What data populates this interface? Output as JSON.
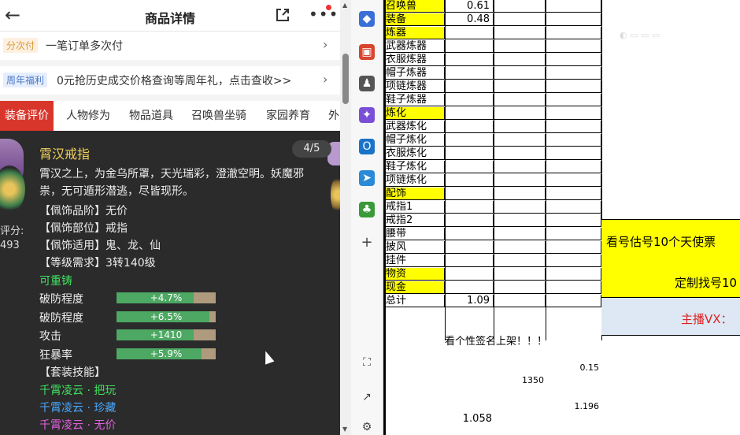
{
  "phone": {
    "title": "商品详情",
    "row1": {
      "tag": "分次付",
      "text": "一笔订单多次付"
    },
    "row2": {
      "tag": "周年福利",
      "text": "0元抢历史成交价格查询等周年礼，点击查收>>"
    },
    "tabs": [
      "装备评价",
      "人物修为",
      "物品道具",
      "召唤兽坐骑",
      "家园养育",
      "外"
    ],
    "card": {
      "name": "霄汉戒指",
      "page": "4/5",
      "score_label": "评分:",
      "score_value": "493",
      "desc": "霄汉之上，为金乌所罩，天光瑞彩，澄澈空明。妖魔邪祟，无可遁形潜逃，尽皆现形。",
      "lines": [
        "【佩饰品阶】无价",
        "【佩饰部位】戒指",
        "【佩饰适用】鬼、龙、仙",
        "【等级需求】3转140级"
      ],
      "recast": "可重铸",
      "stats": [
        {
          "label": "破防程度",
          "value": "+4.7%",
          "fill": 0.78
        },
        {
          "label": "破防程度",
          "value": "+6.5%",
          "fill": 0.94
        },
        {
          "label": "攻击",
          "value": "+1410",
          "fill": 0.78
        },
        {
          "label": "狂暴率",
          "value": "+5.9%",
          "fill": 0.86
        }
      ],
      "set_title": "【套装技能】",
      "set_items": [
        "千霄凌云 · 把玩",
        "千霄凌云 · 珍藏",
        "千霄凌云 · 无价"
      ]
    }
  },
  "sheet": {
    "rows": [
      {
        "label": "召唤兽",
        "val": "0.61",
        "yellow": true
      },
      {
        "label": "装备",
        "val": "0.48",
        "yellow": true
      },
      {
        "label": "炼器",
        "val": "",
        "yellow": true
      },
      {
        "label": "武器炼器",
        "val": "",
        "yellow": false
      },
      {
        "label": "衣服炼器",
        "val": "",
        "yellow": false
      },
      {
        "label": "帽子炼器",
        "val": "",
        "yellow": false
      },
      {
        "label": "项链炼器",
        "val": "",
        "yellow": false
      },
      {
        "label": "鞋子炼器",
        "val": "",
        "yellow": false
      },
      {
        "label": "炼化",
        "val": "",
        "yellow": true
      },
      {
        "label": "武器炼化",
        "val": "",
        "yellow": false
      },
      {
        "label": "帽子炼化",
        "val": "",
        "yellow": false
      },
      {
        "label": "衣服炼化",
        "val": "",
        "yellow": false
      },
      {
        "label": "鞋子炼化",
        "val": "",
        "yellow": false
      },
      {
        "label": "项链炼化",
        "val": "",
        "yellow": false
      },
      {
        "label": "配饰",
        "val": "",
        "yellow": true
      },
      {
        "label": "戒指1",
        "val": "",
        "yellow": false
      },
      {
        "label": "戒指2",
        "val": "",
        "yellow": false
      },
      {
        "label": "腰带",
        "val": "",
        "yellow": false
      },
      {
        "label": "披风",
        "val": "",
        "yellow": false
      },
      {
        "label": "挂件",
        "val": "",
        "yellow": false
      },
      {
        "label": "物资",
        "val": "",
        "yellow": true
      },
      {
        "label": "现金",
        "val": "",
        "yellow": true
      },
      {
        "label": "总计",
        "val": "1.09",
        "yellow": false
      }
    ],
    "signature": "看个性签名上架！！！",
    "extra_numbers": [
      {
        "text": "0.15"
      },
      {
        "text": "1350"
      },
      {
        "text": "1.196"
      },
      {
        "text": "1.058"
      }
    ],
    "ads": [
      "看号估号10个天使票",
      "定制找号10",
      "主播VX："
    ]
  }
}
